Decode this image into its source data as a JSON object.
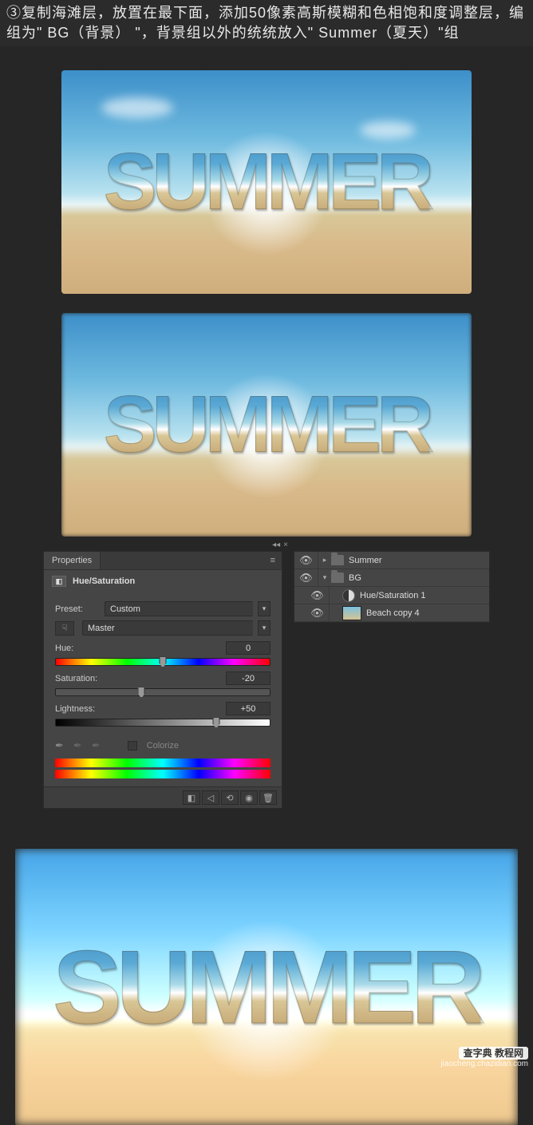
{
  "instruction": "③复制海滩层，放置在最下面，添加50像素高斯模糊和色相饱和度调整层，编组为\" BG（背景） \"，背景组以外的统统放入\" Summer（夏天）\"组",
  "summer_word": "SUMMER",
  "properties": {
    "tab": "Properties",
    "adjustment": "Hue/Saturation",
    "preset_label": "Preset:",
    "preset_value": "Custom",
    "channel_value": "Master",
    "hue_label": "Hue:",
    "hue_value": "0",
    "sat_label": "Saturation:",
    "sat_value": "-20",
    "light_label": "Lightness:",
    "light_value": "+50",
    "colorize_label": "Colorize"
  },
  "layers": {
    "group1": "Summer",
    "group2": "BG",
    "adj_layer": "Hue/Saturation 1",
    "img_layer": "Beach copy 4"
  },
  "watermark": {
    "brand": "查字典 教程网",
    "url": "jiaocheng.chazidian.com"
  },
  "icons": {
    "eye": "👁",
    "menu": "≡",
    "caret": "▾",
    "tri_right": "▸",
    "tri_down": "▾",
    "finger": "☟",
    "dropper": "✒",
    "trash": "🗑",
    "reset": "⟲",
    "clip": "◧",
    "view": "◉",
    "prev": "◁"
  }
}
